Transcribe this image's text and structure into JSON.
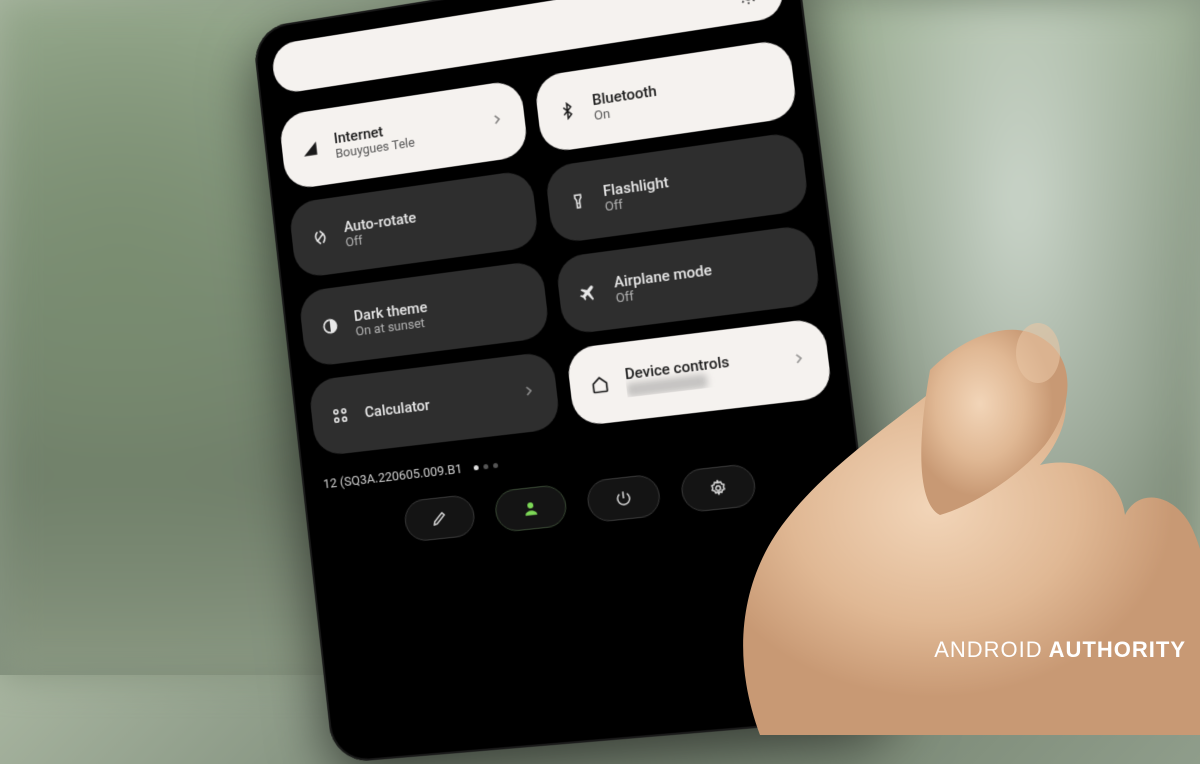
{
  "brightness": {
    "icon": "brightness"
  },
  "tiles": [
    {
      "icon": "signal",
      "title": "Internet",
      "sub": "Bouygues Tele",
      "active": true,
      "chevron": true
    },
    {
      "icon": "bluetooth",
      "title": "Bluetooth",
      "sub": "On",
      "active": true,
      "chevron": false
    },
    {
      "icon": "rotate",
      "title": "Auto-rotate",
      "sub": "Off",
      "active": false,
      "chevron": false
    },
    {
      "icon": "flashlight",
      "title": "Flashlight",
      "sub": "Off",
      "active": false,
      "chevron": false
    },
    {
      "icon": "darktheme",
      "title": "Dark theme",
      "sub": "On at sunset",
      "active": false,
      "chevron": false
    },
    {
      "icon": "airplane",
      "title": "Airplane mode",
      "sub": "Off",
      "active": false,
      "chevron": false
    },
    {
      "icon": "calculator",
      "title": "Calculator",
      "sub": "",
      "active": false,
      "chevron": true
    },
    {
      "icon": "home",
      "title": "Device controls",
      "sub": "",
      "active": true,
      "chevron": true,
      "blurred_sub": true
    }
  ],
  "build": "12 (SQ3A.220605.009.B1",
  "page_dots": {
    "count": 3,
    "active": 0
  },
  "bottom_buttons": [
    {
      "name": "edit",
      "icon": "pencil"
    },
    {
      "name": "user",
      "icon": "user",
      "accent": true
    },
    {
      "name": "power",
      "icon": "power"
    },
    {
      "name": "settings",
      "icon": "gear"
    }
  ],
  "watermark": {
    "word1": "ANDROID",
    "word2": "AUTHORITY"
  }
}
